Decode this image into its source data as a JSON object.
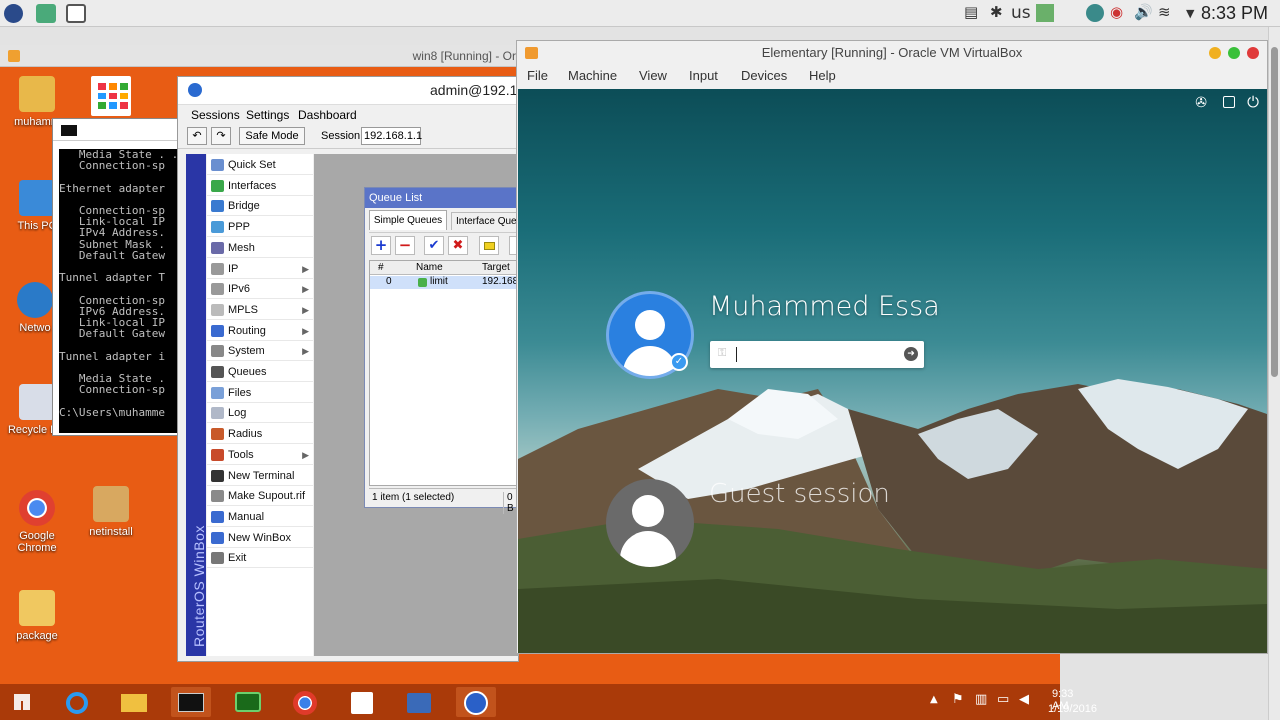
{
  "topbar": {
    "keyboard_layout": "us",
    "clock": "8:33 PM"
  },
  "win8_vm": {
    "title": "win8 [Running] - Or",
    "desktop_icons": [
      {
        "label": "muhamm"
      },
      {
        "label": "This PC"
      },
      {
        "label": "Netwo"
      },
      {
        "label": "Recycle Bin"
      },
      {
        "label": "Google Chrome"
      },
      {
        "label": "netinstall"
      },
      {
        "label": "package"
      }
    ],
    "taskbar": {
      "time": "9:33 AM",
      "date": "1/19/2016"
    },
    "cmd": {
      "lines": [
        "   Media State . .",
        "   Connection-sp",
        "",
        "Ethernet adapter",
        "",
        "   Connection-sp",
        "   Link-local IP",
        "   IPv4 Address.",
        "   Subnet Mask .",
        "   Default Gatew",
        "",
        "Tunnel adapter T",
        "",
        "   Connection-sp",
        "   IPv6 Address.",
        "   Link-local IP",
        "   Default Gatew",
        "",
        "Tunnel adapter i",
        "",
        "   Media State .",
        "   Connection-sp",
        "",
        "C:\\Users\\muhamme"
      ]
    },
    "winbox": {
      "title": "admin@192.1",
      "menu": [
        "Sessions",
        "Settings",
        "Dashboard"
      ],
      "safe_mode": "Safe Mode",
      "session_label": "Session:",
      "session_value": "192.168.1.1",
      "brand": "RouterOS WinBox",
      "nav": [
        {
          "label": "Quick Set",
          "color": "#6a8fd0",
          "arrow": ""
        },
        {
          "label": "Interfaces",
          "color": "#3aa84a",
          "arrow": ""
        },
        {
          "label": "Bridge",
          "color": "#3a7ad0",
          "arrow": ""
        },
        {
          "label": "PPP",
          "color": "#4a9ad8",
          "arrow": ""
        },
        {
          "label": "Mesh",
          "color": "#6a6aa8",
          "arrow": ""
        },
        {
          "label": "IP",
          "color": "#999999",
          "arrow": "▶"
        },
        {
          "label": "IPv6",
          "color": "#999999",
          "arrow": "▶"
        },
        {
          "label": "MPLS",
          "color": "#bbbbbb",
          "arrow": "▶"
        },
        {
          "label": "Routing",
          "color": "#3a6ad0",
          "arrow": "▶"
        },
        {
          "label": "System",
          "color": "#888888",
          "arrow": "▶"
        },
        {
          "label": "Queues",
          "color": "#555555",
          "arrow": ""
        },
        {
          "label": "Files",
          "color": "#7aa0d8",
          "arrow": ""
        },
        {
          "label": "Log",
          "color": "#b0b8c8",
          "arrow": ""
        },
        {
          "label": "Radius",
          "color": "#c85a2a",
          "arrow": ""
        },
        {
          "label": "Tools",
          "color": "#c84a2a",
          "arrow": "▶"
        },
        {
          "label": "New Terminal",
          "color": "#333333",
          "arrow": ""
        },
        {
          "label": "Make Supout.rif",
          "color": "#8a8a8a",
          "arrow": ""
        },
        {
          "label": "Manual",
          "color": "#3a6ad0",
          "arrow": ""
        },
        {
          "label": "New WinBox",
          "color": "#3a6ad0",
          "arrow": ""
        },
        {
          "label": "Exit",
          "color": "#777777",
          "arrow": ""
        }
      ]
    },
    "queue_list": {
      "title": "Queue List",
      "tabs": [
        "Simple Queues",
        "Interface Queu"
      ],
      "columns": [
        "#",
        "Name",
        "Target"
      ],
      "rows": [
        {
          "num": "0",
          "name": "limit",
          "target": "192.168"
        }
      ],
      "status": "1 item (1 selected)",
      "status_right": "0 B"
    }
  },
  "virtualbox": {
    "title": "Elementary [Running] - Oracle VM VirtualBox",
    "menu": [
      "File",
      "Machine",
      "View",
      "Input",
      "Devices",
      "Help"
    ],
    "login": {
      "user_name": "Muhammed Essa",
      "guest_label": "Guest session"
    }
  }
}
